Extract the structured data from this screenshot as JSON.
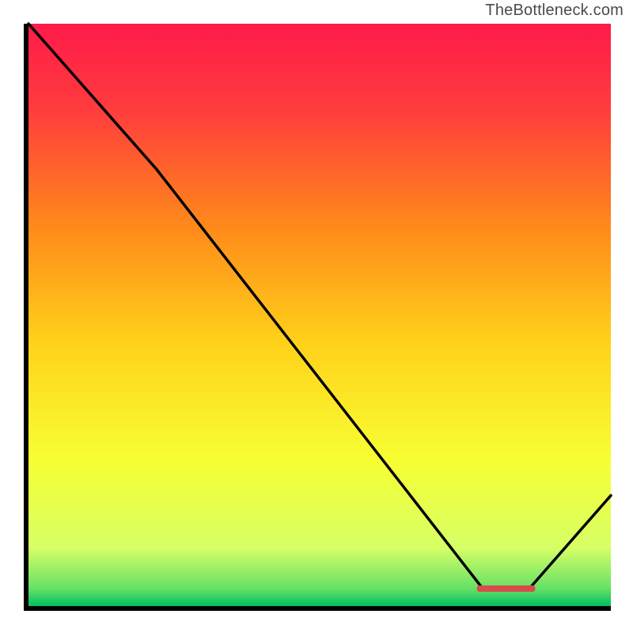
{
  "attribution": "TheBottleneck.com",
  "chart_data": {
    "type": "line",
    "title": "",
    "xlabel": "",
    "ylabel": "",
    "xlim": [
      0,
      100
    ],
    "ylim": [
      0,
      100
    ],
    "grid": false,
    "background": {
      "gradient_stops": [
        {
          "pos": 0.0,
          "color": "#ff1a4a"
        },
        {
          "pos": 0.15,
          "color": "#ff3d3d"
        },
        {
          "pos": 0.35,
          "color": "#ff8a1a"
        },
        {
          "pos": 0.55,
          "color": "#ffd21a"
        },
        {
          "pos": 0.75,
          "color": "#f7ff33"
        },
        {
          "pos": 0.9,
          "color": "#d6ff66"
        },
        {
          "pos": 0.97,
          "color": "#66e066"
        },
        {
          "pos": 1.0,
          "color": "#00c060"
        }
      ]
    },
    "series": [
      {
        "name": "bottleneck-curve",
        "color": "#000000",
        "x": [
          0,
          22,
          78,
          86,
          100
        ],
        "y": [
          100,
          75,
          3,
          3,
          19
        ]
      }
    ],
    "markers": [
      {
        "name": "optimal-threshold",
        "shape": "bar",
        "color": "#d94a4a",
        "x_range": [
          77,
          87
        ],
        "y": 3
      }
    ]
  }
}
